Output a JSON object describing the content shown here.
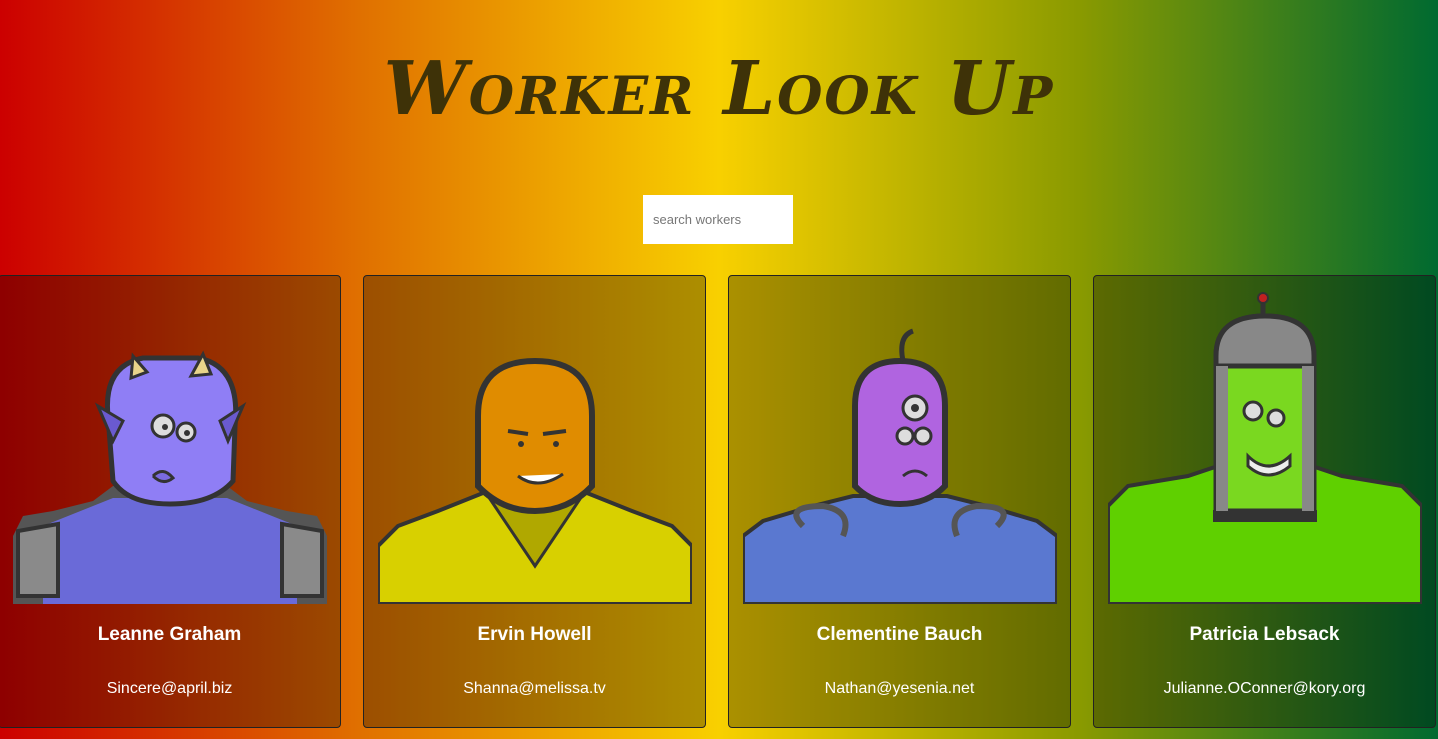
{
  "page": {
    "title": "Worker Look Up"
  },
  "search": {
    "placeholder": "search workers",
    "value": ""
  },
  "workers": [
    {
      "name": "Leanne Graham",
      "email": "Sincere@april.biz",
      "avatar": "purple-horned-monster-avatar"
    },
    {
      "name": "Ervin Howell",
      "email": "Shanna@melissa.tv",
      "avatar": "orange-hooded-monster-avatar"
    },
    {
      "name": "Clementine Bauch",
      "email": "Nathan@yesenia.net",
      "avatar": "purple-three-eyed-monster-avatar"
    },
    {
      "name": "Patricia Lebsack",
      "email": "Julianne.OConner@kory.org",
      "avatar": "green-robot-helmet-monster-avatar"
    }
  ],
  "colors": {
    "gradient": [
      "#cc0000",
      "#e07000",
      "#f8d000",
      "#8a9a00",
      "#006a30"
    ],
    "title": "#3e3208"
  }
}
